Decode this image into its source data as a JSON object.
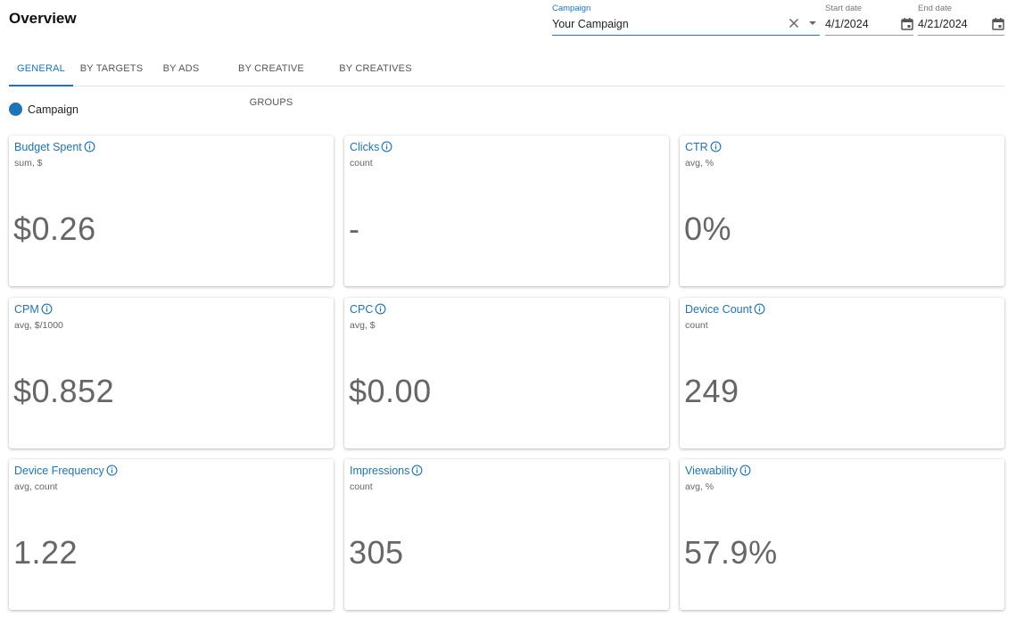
{
  "header": {
    "title": "Overview"
  },
  "filters": {
    "campaign": {
      "label": "Campaign",
      "value": "Your Campaign"
    },
    "start_date": {
      "label": "Start date",
      "value": "4/1/2024"
    },
    "end_date": {
      "label": "End date",
      "value": "4/21/2024"
    }
  },
  "tabs": [
    {
      "label": "GENERAL",
      "active": true
    },
    {
      "label": "BY TARGETS"
    },
    {
      "label": "BY ADS"
    },
    {
      "label": "BY CREATIVE GROUPS"
    },
    {
      "label": "BY CREATIVES"
    }
  ],
  "legend": {
    "label": "Campaign",
    "color": "#1f73b7"
  },
  "metrics": [
    {
      "title": "Budget Spent",
      "sub": "sum, $",
      "value": "$0.26"
    },
    {
      "title": "Clicks",
      "sub": "count",
      "value": "-"
    },
    {
      "title": "CTR",
      "sub": "avg, %",
      "value": "0%"
    },
    {
      "title": "CPM",
      "sub": "avg, $/1000",
      "value": "$0.852"
    },
    {
      "title": "CPC",
      "sub": "avg, $",
      "value": "$0.00"
    },
    {
      "title": "Device Count",
      "sub": "count",
      "value": "249"
    },
    {
      "title": "Device Frequency",
      "sub": "avg, count",
      "value": "1.22"
    },
    {
      "title": "Impressions",
      "sub": "count",
      "value": "305"
    },
    {
      "title": "Viewability",
      "sub": "avg, %",
      "value": "57.9%"
    }
  ],
  "colors": {
    "accent": "#1f73b7",
    "value_text": "#666666"
  }
}
